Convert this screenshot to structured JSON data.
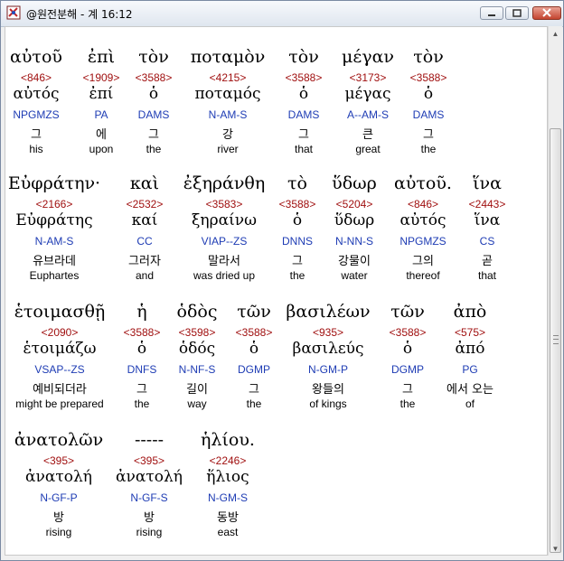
{
  "window": {
    "title": "@원전분해 - 계 16:12",
    "icon": "app-icon",
    "buttons": [
      "minimize-icon",
      "maximize-icon",
      "close-icon"
    ]
  },
  "lines": [
    {
      "words": [
        {
          "greek": "αὐτοῦ",
          "strong": "<846>",
          "lemma": "αὐτός",
          "parsing": "NPGMZS",
          "korean": "그",
          "english": "his"
        },
        {
          "greek": "ἐπὶ",
          "strong": "<1909>",
          "lemma": "ἐπί",
          "parsing": "PA",
          "korean": "에",
          "english": "upon"
        },
        {
          "greek": "τὸν",
          "strong": "<3588>",
          "lemma": "ὁ",
          "parsing": "DAMS",
          "korean": "그",
          "english": "the"
        },
        {
          "greek": "ποταμὸν",
          "strong": "<4215>",
          "lemma": "ποταμός",
          "parsing": "N-AM-S",
          "korean": "강",
          "english": "river"
        },
        {
          "greek": "τὸν",
          "strong": "<3588>",
          "lemma": "ὁ",
          "parsing": "DAMS",
          "korean": "그",
          "english": "that"
        },
        {
          "greek": "μέγαν",
          "strong": "<3173>",
          "lemma": "μέγας",
          "parsing": "A--AM-S",
          "korean": "큰",
          "english": "great"
        },
        {
          "greek": "τὸν",
          "strong": "<3588>",
          "lemma": "ὁ",
          "parsing": "DAMS",
          "korean": "그",
          "english": "the"
        }
      ]
    },
    {
      "words": [
        {
          "greek": "Εὐφράτην·",
          "strong": "<2166>",
          "lemma": "Εὐφράτης",
          "parsing": "N-AM-S",
          "korean": "유브라데",
          "english": "Euphartes"
        },
        {
          "greek": "καὶ",
          "strong": "<2532>",
          "lemma": "καί",
          "parsing": "CC",
          "korean": "그러자",
          "english": "and"
        },
        {
          "greek": "ἐξηράνθη",
          "strong": "<3583>",
          "lemma": "ξηραίνω",
          "parsing": "VIAP--ZS",
          "korean": "말라서",
          "english": "was dried up"
        },
        {
          "greek": "τὸ",
          "strong": "<3588>",
          "lemma": "ὁ",
          "parsing": "DNNS",
          "korean": "그",
          "english": "the"
        },
        {
          "greek": "ὕδωρ",
          "strong": "<5204>",
          "lemma": "ὕδωρ",
          "parsing": "N-NN-S",
          "korean": "강물이",
          "english": "water"
        },
        {
          "greek": "αὐτοῦ.",
          "strong": "<846>",
          "lemma": "αὐτός",
          "parsing": "NPGMZS",
          "korean": "그의",
          "english": "thereof"
        },
        {
          "greek": "ἵνα",
          "strong": "<2443>",
          "lemma": "ἵνα",
          "parsing": "CS",
          "korean": "곧",
          "english": "that"
        }
      ]
    },
    {
      "words": [
        {
          "greek": "ἑτοιμασθῇ",
          "strong": "<2090>",
          "lemma": "ἑτοιμάζω",
          "parsing": "VSAP--ZS",
          "korean": "예비되더라",
          "english": "might be prepared"
        },
        {
          "greek": "ἡ",
          "strong": "<3588>",
          "lemma": "ὁ",
          "parsing": "DNFS",
          "korean": "그",
          "english": "the"
        },
        {
          "greek": "ὁδὸς",
          "strong": "<3598>",
          "lemma": "ὁδός",
          "parsing": "N-NF-S",
          "korean": "길이",
          "english": "way"
        },
        {
          "greek": "τῶν",
          "strong": "<3588>",
          "lemma": "ὁ",
          "parsing": "DGMP",
          "korean": "그",
          "english": "the"
        },
        {
          "greek": "βασιλέων",
          "strong": "<935>",
          "lemma": "βασιλεύς",
          "parsing": "N-GM-P",
          "korean": "왕들의",
          "english": "of kings"
        },
        {
          "greek": "τῶν",
          "strong": "<3588>",
          "lemma": "ὁ",
          "parsing": "DGMP",
          "korean": "그",
          "english": "the"
        },
        {
          "greek": "ἀπὸ",
          "strong": "<575>",
          "lemma": "ἀπό",
          "parsing": "PG",
          "korean": "에서 오는",
          "english": "of"
        }
      ]
    },
    {
      "words": [
        {
          "greek": "ἀνατολῶν",
          "strong": "<395>",
          "lemma": "ἀνατολή",
          "parsing": "N-GF-P",
          "korean": "방",
          "english": "rising"
        },
        {
          "greek": "-----",
          "strong": "<395>",
          "lemma": "ἀνατολή",
          "parsing": "N-GF-S",
          "korean": "방",
          "english": "rising"
        },
        {
          "greek": "ἡλίου.",
          "strong": "<2246>",
          "lemma": "ἥλιος",
          "parsing": "N-GM-S",
          "korean": "동방",
          "english": "east"
        }
      ]
    }
  ]
}
